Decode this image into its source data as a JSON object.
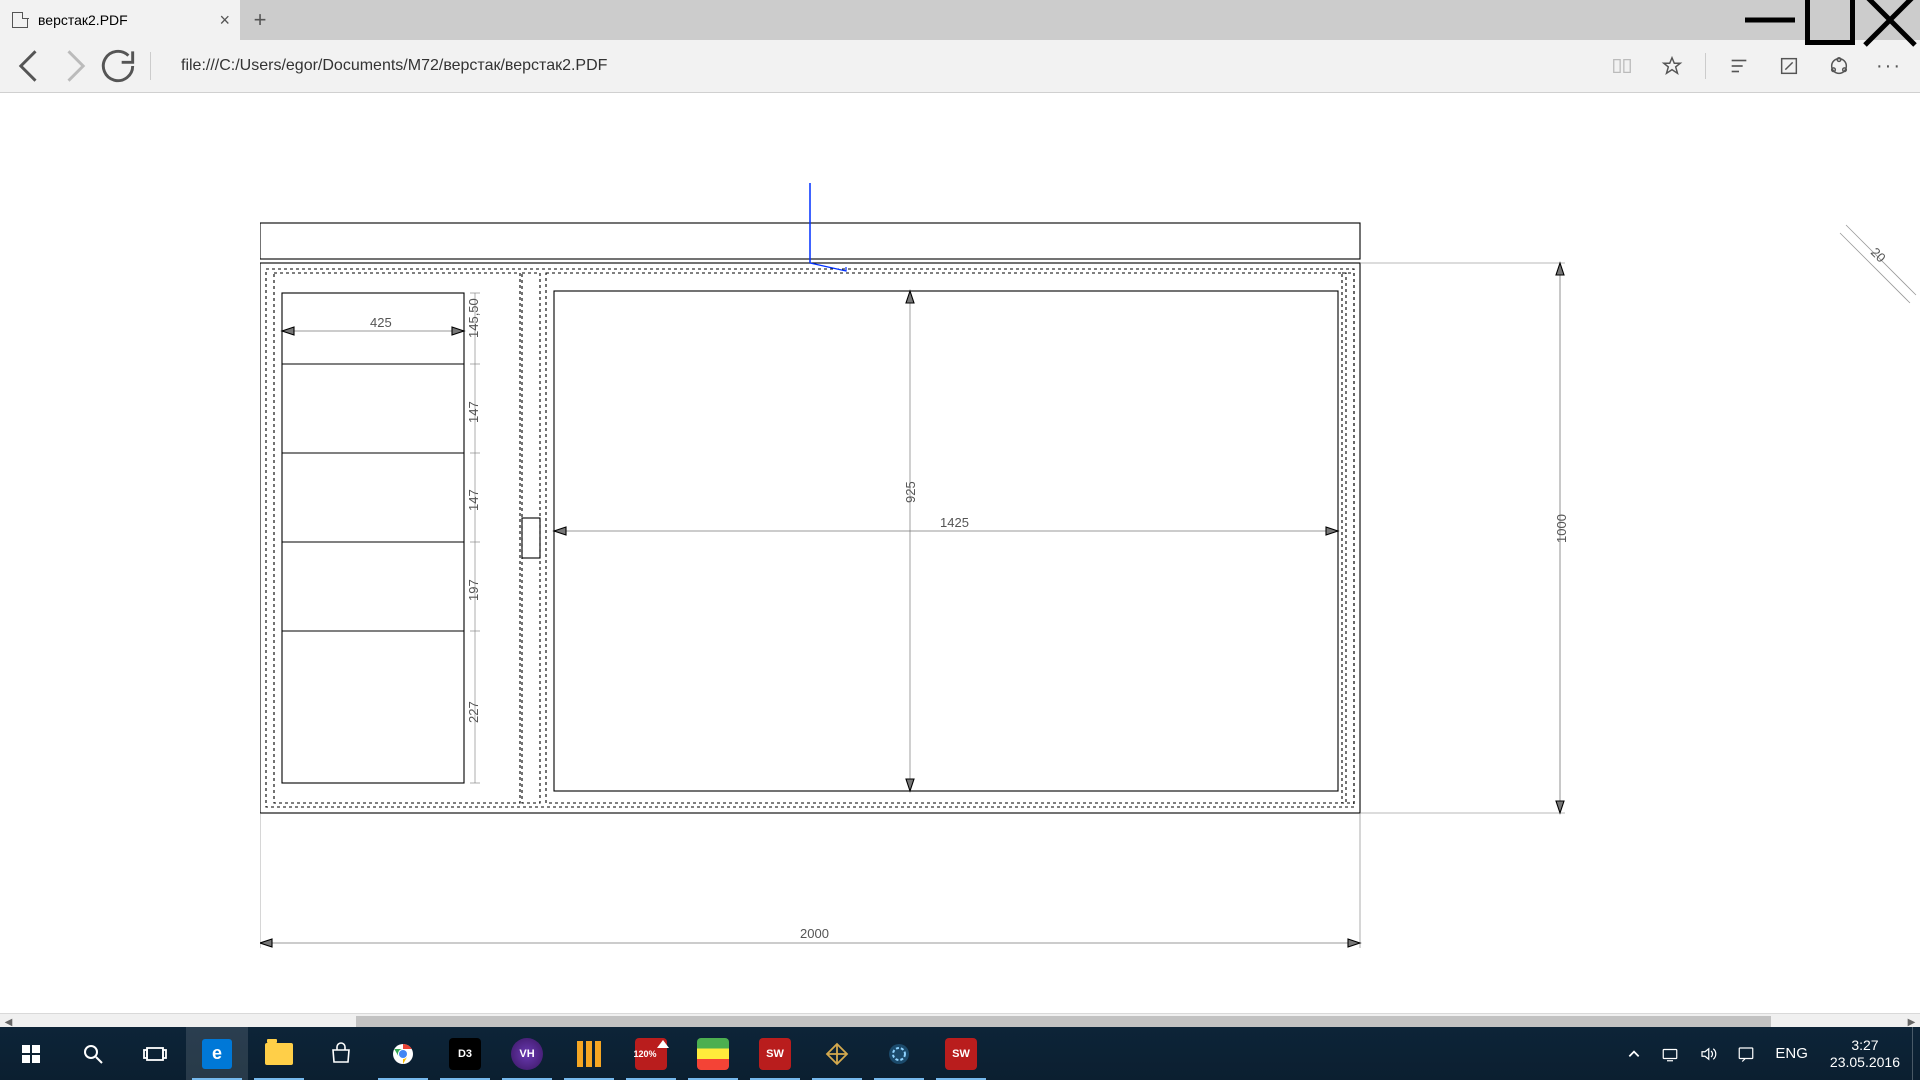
{
  "tab": {
    "title": "верстак2.PDF"
  },
  "address": "file:///C:/Users/egor/Documents/M72/верстак/верстак2.PDF",
  "drawing": {
    "dims": {
      "width_overall": "2000",
      "height_overall": "1000",
      "right_compartment_width": "1425",
      "right_compartment_half_height": "925",
      "left_shelf_width": "425",
      "shelf_h1": "145,50",
      "shelf_h2": "147",
      "shelf_h3": "147",
      "shelf_h4": "197",
      "shelf_h5": "227",
      "corner_mark": "20"
    }
  },
  "scrollbar": {
    "thumb_start_pct": 18,
    "thumb_width_pct": 75
  },
  "tray": {
    "lang": "ENG",
    "time": "3:27",
    "date": "23.05.2016"
  }
}
